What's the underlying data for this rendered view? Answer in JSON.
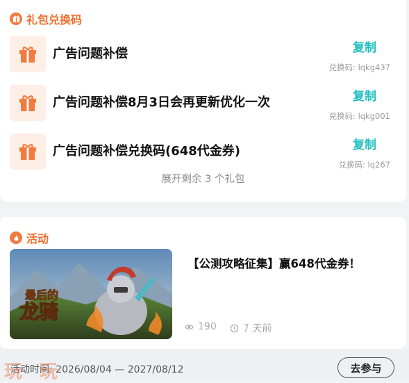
{
  "gift_section": {
    "title": "礼包兑换码",
    "items": [
      {
        "name": "广告问题补偿",
        "copy_label": "复制",
        "code": "兑换码: lqkg437"
      },
      {
        "name": "广告问题补偿8月3日会再更新优化一次",
        "copy_label": "复制",
        "code": "兑换码: lqkg001"
      },
      {
        "name": "广告问题补偿兑换码(648代金券)",
        "copy_label": "复制",
        "code": "兑换码: lq267"
      }
    ],
    "expand_label": "展开剩余 3 个礼包"
  },
  "activity_section": {
    "title": "活动",
    "thumbnail_text": "最后的龙骑",
    "post_title": "【公测攻略征集】赢648代金券！",
    "views": "190",
    "time_ago": "7 天前"
  },
  "footer": {
    "time_range": "活动时间: 2026/08/04 — 2027/08/12",
    "join_label": "去参与",
    "watermark": "玩 玩"
  },
  "colors": {
    "accent": "#ee6f2d",
    "copy": "#1fbfbf"
  }
}
